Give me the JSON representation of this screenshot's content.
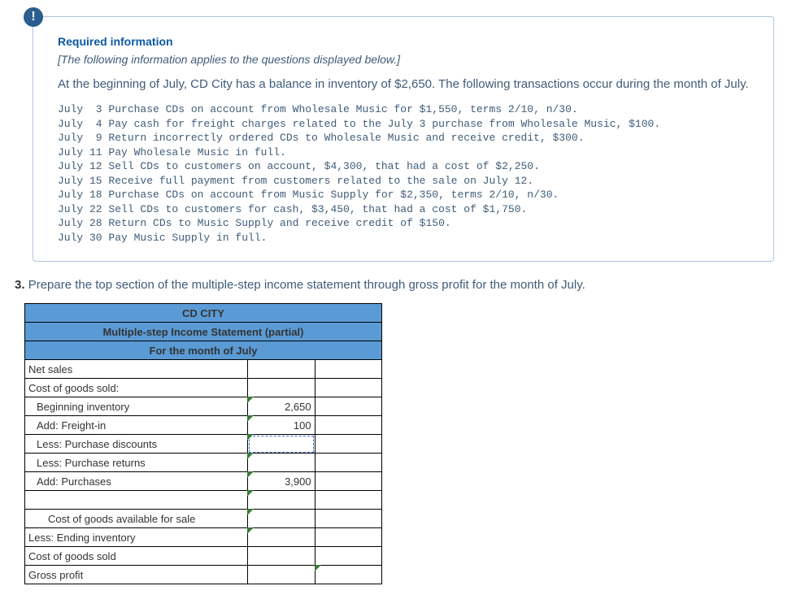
{
  "info": {
    "heading": "Required information",
    "subhead": "[The following information applies to the questions displayed below.]",
    "intro": "At the beginning of July, CD City has a balance in inventory of $2,650. The following transactions occur during the month of July.",
    "transactions": [
      "July  3 Purchase CDs on account from Wholesale Music for $1,550, terms 2/10, n/30.",
      "July  4 Pay cash for freight charges related to the July 3 purchase from Wholesale Music, $100.",
      "July  9 Return incorrectly ordered CDs to Wholesale Music and receive credit, $300.",
      "July 11 Pay Wholesale Music in full.",
      "July 12 Sell CDs to customers on account, $4,300, that had a cost of $2,250.",
      "July 15 Receive full payment from customers related to the sale on July 12.",
      "July 18 Purchase CDs on account from Music Supply for $2,350, terms 2/10, n/30.",
      "July 22 Sell CDs to customers for cash, $3,450, that had a cost of $1,750.",
      "July 28 Return CDs to Music Supply and receive credit of $150.",
      "July 30 Pay Music Supply in full."
    ]
  },
  "question": {
    "number": "3.",
    "text": "Prepare the top section of the multiple-step income statement through gross profit for the month of July."
  },
  "stmt": {
    "title1": "CD CITY",
    "title2": "Multiple-step Income Statement (partial)",
    "title3": "For the month of July",
    "rows": {
      "net_sales": "Net sales",
      "cogs_label": "Cost of goods sold:",
      "beg_inv": "Beginning inventory",
      "beg_inv_val": "2,650",
      "freight": "Add: Freight-in",
      "freight_val": "100",
      "purch_disc": "Less: Purchase discounts",
      "purch_ret": "Less: Purchase returns",
      "purchases": "Add: Purchases",
      "purchases_val": "3,900",
      "cogas": "Cost of goods available for sale",
      "end_inv": "Less: Ending inventory",
      "cogs": "Cost of goods sold",
      "gp": "Gross profit"
    }
  }
}
